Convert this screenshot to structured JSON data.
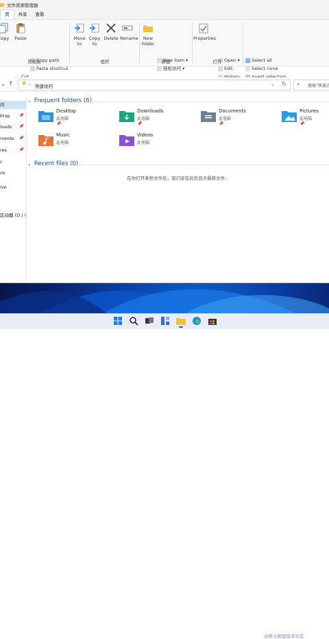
{
  "window": {
    "title": "文件资源管理器"
  },
  "ribbon_tabs": [
    "页",
    "共享",
    "查看"
  ],
  "ribbon": {
    "clipboard": {
      "copy": "Copy",
      "paste": "Paste",
      "copy_path": "Copy path",
      "paste_shortcut": "Paste shortcut",
      "cut": "Cut",
      "label": "剪贴板"
    },
    "organize": {
      "move_to": "Move to",
      "copy_to": "Copy to",
      "delete": "Delete",
      "rename": "Rename",
      "label": "组织"
    },
    "new": {
      "new_folder": "New folder",
      "new_item": "New item",
      "easy_access": "轻松访问",
      "label": "新建"
    },
    "open": {
      "properties": "Properties",
      "open": "Open",
      "edit": "Edit",
      "history": "History",
      "label": "打开"
    },
    "select": {
      "select_all": "Select all",
      "select_none": "Select none",
      "invert_selection": "Invert selection"
    }
  },
  "address": {
    "path": "快速访问",
    "search_placeholder": "搜索\"快速访问\""
  },
  "nav_items": [
    {
      "label": "问",
      "pinned": false,
      "selected": true
    },
    {
      "label": "ktop",
      "pinned": true
    },
    {
      "label": "loads",
      "pinned": true
    },
    {
      "label": "ments",
      "pinned": true
    },
    {
      "label": "res",
      "pinned": true
    },
    {
      "label": "c",
      "pinned": false
    },
    {
      "label": "os",
      "pinned": false
    },
    {
      "label": "ive",
      "pinned": false
    },
    {
      "label": "区动器 (D:) CC",
      "pinned": false
    }
  ],
  "content": {
    "frequent_header": "Frequent folders (6)",
    "recent_header": "Recent files (0)",
    "empty_message": "在你打开某些文件后，我们会在此处显示最新文件。",
    "folders": [
      {
        "name": "Desktop",
        "location": "此电脑",
        "pinned": true,
        "icon": "desktop-folder-icon",
        "color": "#2f8fd8"
      },
      {
        "name": "Downloads",
        "location": "此电脑",
        "pinned": true,
        "icon": "downloads-folder-icon",
        "color": "#1fa37a"
      },
      {
        "name": "Documents",
        "location": "此电脑",
        "pinned": true,
        "icon": "documents-folder-icon",
        "color": "#6f7f95"
      },
      {
        "name": "Pictures",
        "location": "此电脑",
        "pinned": true,
        "icon": "pictures-folder-icon",
        "color": "#2d9be0"
      },
      {
        "name": "Music",
        "location": "此电脑",
        "pinned": false,
        "icon": "music-folder-icon",
        "color": "#e8743b"
      },
      {
        "name": "Videos",
        "location": "此电脑",
        "pinned": false,
        "icon": "videos-folder-icon",
        "color": "#8b4fd8"
      }
    ]
  },
  "taskbar_icons": [
    "start-icon",
    "search-icon",
    "task-view-icon",
    "widgets-icon",
    "file-explorer-icon",
    "edge-icon",
    "store-icon"
  ],
  "watermark": "@稀土掘金技术社区"
}
